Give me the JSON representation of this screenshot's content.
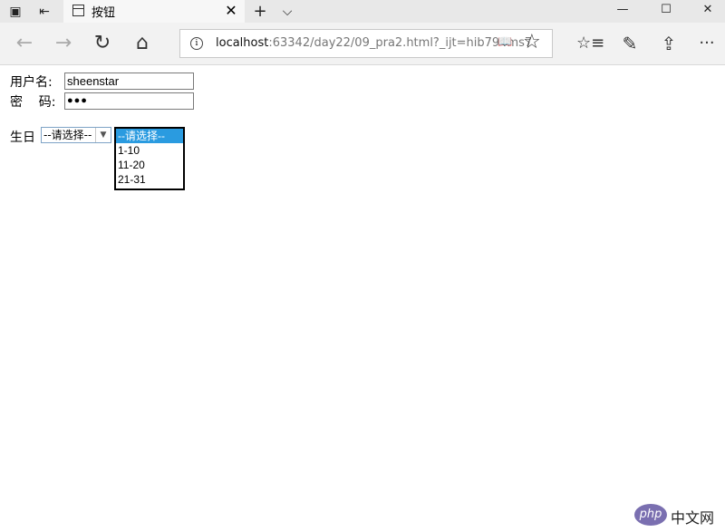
{
  "browser": {
    "tab_title": "按钮",
    "tab_close": "✕",
    "new_tab": "+",
    "tab_list": "⌵",
    "window_minimize": "—",
    "window_maximize": "☐",
    "window_close": "✕",
    "nav_back": "←",
    "nav_forward": "→",
    "nav_refresh": "↻",
    "nav_home": "⌂",
    "address_host": "localhost",
    "address_rest": ":63342/day22/09_pra2.html?_ijt=hib794ms7",
    "favorites": "☆",
    "hub": "☆≡",
    "notes": "✎",
    "share": "⇪",
    "more": "···"
  },
  "form": {
    "username_label": "用户名:",
    "username_value": "sheenstar",
    "password_label": "密    码:",
    "password_value": "●●●",
    "birthday_label": "生日",
    "select_value": "--请选择--",
    "options": [
      "--请选择--",
      "1-10",
      "11-20",
      "21-31"
    ]
  },
  "watermark": {
    "logo": "php",
    "text": "中文网"
  },
  "colors": {
    "selected_option": "#2a9be0",
    "watermark_logo": "#7a6fb0"
  }
}
